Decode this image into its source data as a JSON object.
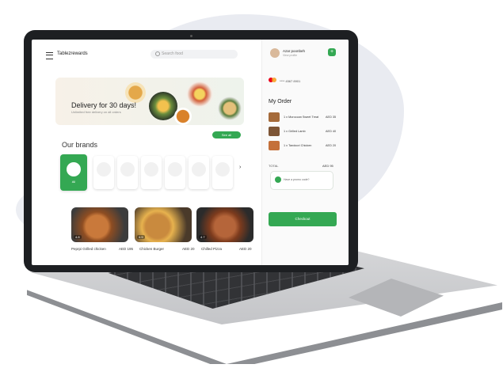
{
  "app": {
    "brand": "Tablezrewards",
    "search_placeholder": "Search food"
  },
  "banner": {
    "title": "Delivery for 30 days!",
    "subtitle": "Unlimited free delivery on all orders"
  },
  "brands": {
    "title": "Our brands",
    "see_all": "See all",
    "active_label": "All"
  },
  "items": [
    {
      "name": "Peprpi Grilled chicken",
      "price": "AED 195",
      "rating": "4.8"
    },
    {
      "name": "Chicken Burger",
      "price": "AED 20",
      "rating": "4.5"
    },
    {
      "name": "Chilled Pizza",
      "price": "AED 20",
      "rating": "4.7"
    }
  ],
  "user": {
    "name": "Azar poonbeh",
    "subtitle": "View profile"
  },
  "payment": {
    "card": "**** 4567 8901"
  },
  "order": {
    "title": "My Order",
    "rows": [
      {
        "qty": "1 x",
        "name": "Moroccan Sweet Treat",
        "price": "AED 35"
      },
      {
        "qty": "1 x",
        "name": "Grilled Lamb",
        "price": "AED 40"
      },
      {
        "qty": "1 x",
        "name": "Tandoori Chicken",
        "price": "AED 20"
      }
    ],
    "total_label": "TOTAL",
    "total_value": "AED 95",
    "promo": "Have a promo code?",
    "checkout": "Checkout"
  },
  "colors": {
    "accent": "#34a853"
  }
}
